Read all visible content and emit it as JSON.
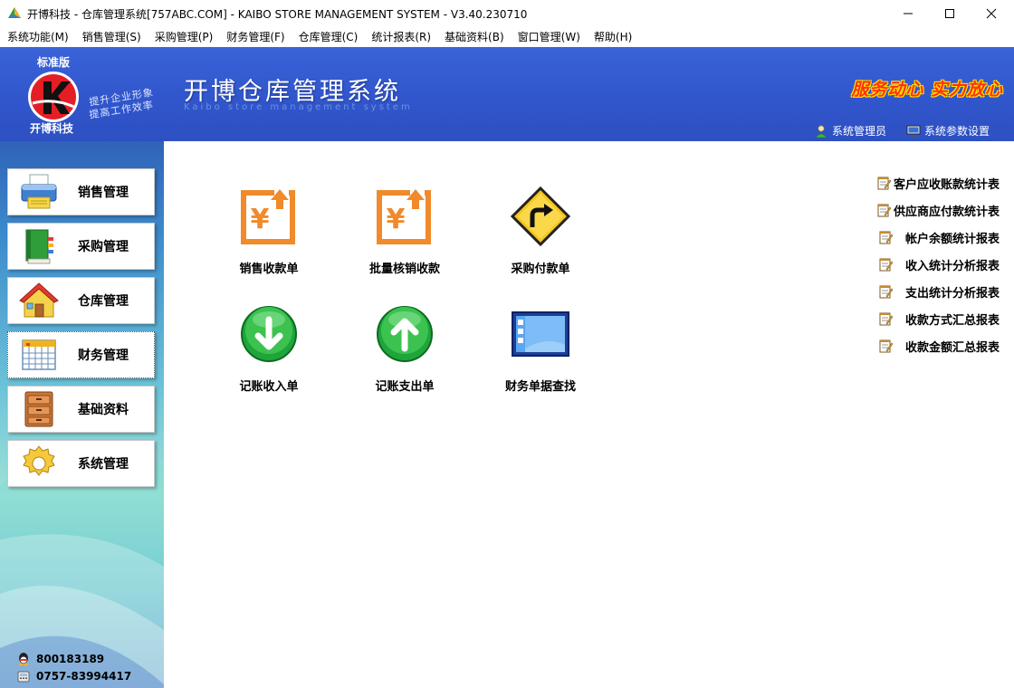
{
  "window": {
    "title": "开博科技 - 仓库管理系统[757ABC.COM] - KAIBO STORE MANAGEMENT SYSTEM - V3.40.230710",
    "minimize_label": "─",
    "maximize_label": "☐",
    "close_label": "✕"
  },
  "menu": [
    {
      "label": "系统功能(M)"
    },
    {
      "label": "销售管理(S)"
    },
    {
      "label": "采购管理(P)"
    },
    {
      "label": "财务管理(F)"
    },
    {
      "label": "仓库管理(C)"
    },
    {
      "label": "统计报表(R)"
    },
    {
      "label": "基础资料(B)"
    },
    {
      "label": "窗口管理(W)"
    },
    {
      "label": "帮助(H)"
    }
  ],
  "header": {
    "edition": "标准版",
    "logo_letter": "K",
    "company": "开博科技",
    "slogan_line1": "提升企业形象",
    "slogan_line2": "提高工作效率",
    "title": "开博仓库管理系统",
    "subtitle": "Kaibo store management system",
    "motto": "服务动心 实力放心",
    "user_label": "系统管理员",
    "settings_label": "系统参数设置"
  },
  "sidebar": {
    "items": [
      {
        "label": "销售管理",
        "icon": "printer-icon"
      },
      {
        "label": "采购管理",
        "icon": "book-icon"
      },
      {
        "label": "仓库管理",
        "icon": "house-icon"
      },
      {
        "label": "财务管理",
        "icon": "calendar-icon",
        "active": true
      },
      {
        "label": "基础资料",
        "icon": "cabinet-icon"
      },
      {
        "label": "系统管理",
        "icon": "gear-icon"
      }
    ],
    "contacts": [
      {
        "icon": "qq-icon",
        "value": "800183189"
      },
      {
        "icon": "phone-icon",
        "value": "0757-83994417"
      }
    ]
  },
  "main": {
    "tiles": [
      {
        "label": "销售收款单",
        "icon": "yen-receipt-icon"
      },
      {
        "label": "批量核销收款",
        "icon": "yen-receipt-icon"
      },
      {
        "label": "采购付款单",
        "icon": "turn-right-sign-icon"
      },
      {
        "label": "记账收入单",
        "icon": "down-arrow-circle-icon"
      },
      {
        "label": "记账支出单",
        "icon": "up-arrow-circle-icon"
      },
      {
        "label": "财务单据查找",
        "icon": "window-list-icon"
      }
    ],
    "reports": [
      {
        "label": "客户应收账款统计表"
      },
      {
        "label": "供应商应付款统计表"
      },
      {
        "label": "帐户余额统计报表"
      },
      {
        "label": "收入统计分析报表"
      },
      {
        "label": "支出统计分析报表"
      },
      {
        "label": "收款方式汇总报表"
      },
      {
        "label": "收款金额汇总报表"
      }
    ]
  },
  "colors": {
    "banner_blue": "#3156cc",
    "motto_red": "#ff3010",
    "arrow_green": "#1fa53a",
    "receipt_orange": "#f08a2a"
  }
}
